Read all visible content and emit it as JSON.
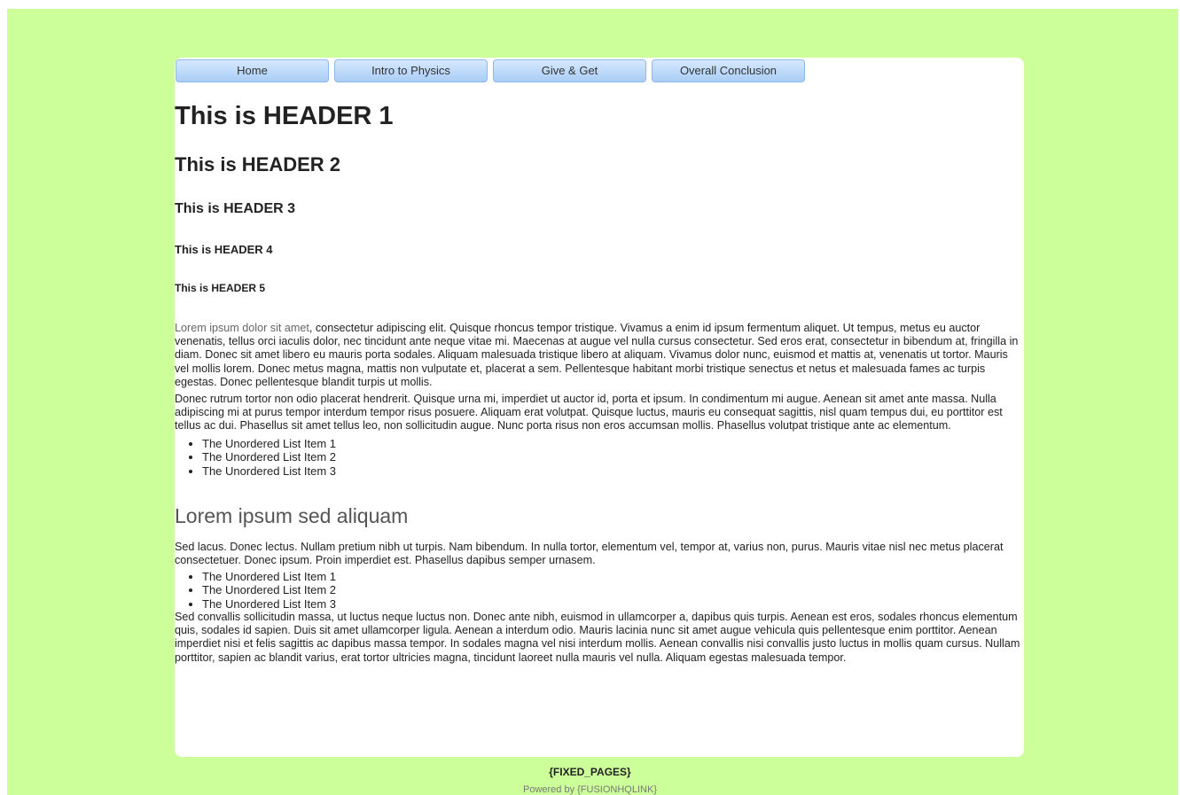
{
  "nav": {
    "items": [
      {
        "label": "Home"
      },
      {
        "label": "Intro to Physics"
      },
      {
        "label": "Give & Get"
      },
      {
        "label": "Overall Conclusion"
      }
    ]
  },
  "headers": {
    "h1": "This is HEADER 1",
    "h2": "This is HEADER 2",
    "h3": "This is HEADER 3",
    "h4": "This is HEADER 4",
    "h5": "This is HEADER 5"
  },
  "para1": {
    "link": "Lorem ipsum dolor sit amet",
    "rest": ", consectetur adipiscing elit. Quisque rhoncus tempor tristique. Vivamus a enim id ipsum fermentum aliquet. Ut tempus, metus eu auctor venenatis, tellus orci iaculis dolor, nec tincidunt ante neque vitae mi. Maecenas at augue vel nulla cursus consectetur. Sed eros erat, consectetur in bibendum at, fringilla in diam. Donec sit amet libero eu mauris porta sodales. Aliquam malesuada tristique libero at aliquam. Vivamus dolor nunc, euismod et mattis at, venenatis ut tortor. Mauris vel mollis lorem. Donec metus magna, mattis non vulputate et, placerat a sem. Pellentesque habitant morbi tristique senectus et netus et malesuada fames ac turpis egestas. Donec pellentesque blandit turpis ut mollis."
  },
  "para2": "Donec rutrum tortor non odio placerat hendrerit. Quisque urna mi, imperdiet ut auctor id, porta et ipsum. In condimentum mi augue. Aenean sit amet ante massa. Nulla adipiscing mi at purus tempor interdum tempor risus posuere. Aliquam erat volutpat. Quisque luctus, mauris eu consequat sagittis, nisl quam tempus dui, eu porttitor est tellus ac dui. Phasellus sit amet tellus leo, non sollicitudin augue. Nunc porta risus non eros accumsan mollis. Phasellus volutpat tristique ante ac elementum.",
  "list1": [
    "The Unordered List Item 1",
    "The Unordered List Item 2",
    "The Unordered List Item 3"
  ],
  "subhead": "Lorem ipsum sed aliquam",
  "para3": "Sed lacus. Donec lectus. Nullam pretium nibh ut turpis. Nam bibendum. In nulla tortor, elementum vel, tempor at, varius non, purus. Mauris vitae nisl nec metus placerat consectetuer. Donec ipsum. Proin imperdiet est. Phasellus dapibus semper urnasem.",
  "list2": [
    "The Unordered List Item 1",
    "The Unordered List Item 2",
    "The Unordered List Item 3"
  ],
  "para4": "Sed convallis sollicitudin massa, ut luctus neque luctus non. Donec ante nibh, euismod in ullamcorper a, dapibus quis turpis. Aenean est eros, sodales rhoncus elementum quis, sodales id sapien. Duis sit amet ullamcorper ligula. Aenean a interdum odio. Mauris lacinia nunc sit amet augue vehicula quis pellentesque enim porttitor. Aenean imperdiet nisi et felis sagittis ac dapibus massa tempor. In sodales magna vel nisi interdum mollis. Aenean convallis nisi convallis justo luctus in mollis quam cursus. Nullam porttitor, sapien ac blandit varius, erat tortor ultricies magna, tincidunt laoreet nulla mauris vel nulla. Aliquam egestas malesuada tempor.",
  "footer": {
    "fixed_pages": "{FIXED_PAGES}",
    "powered": "Powered by {FUSIONHQLINK}"
  },
  "colors": {
    "background": "#ccff99",
    "panel": "#ffffff",
    "nav_button": "#a9cdf6"
  }
}
